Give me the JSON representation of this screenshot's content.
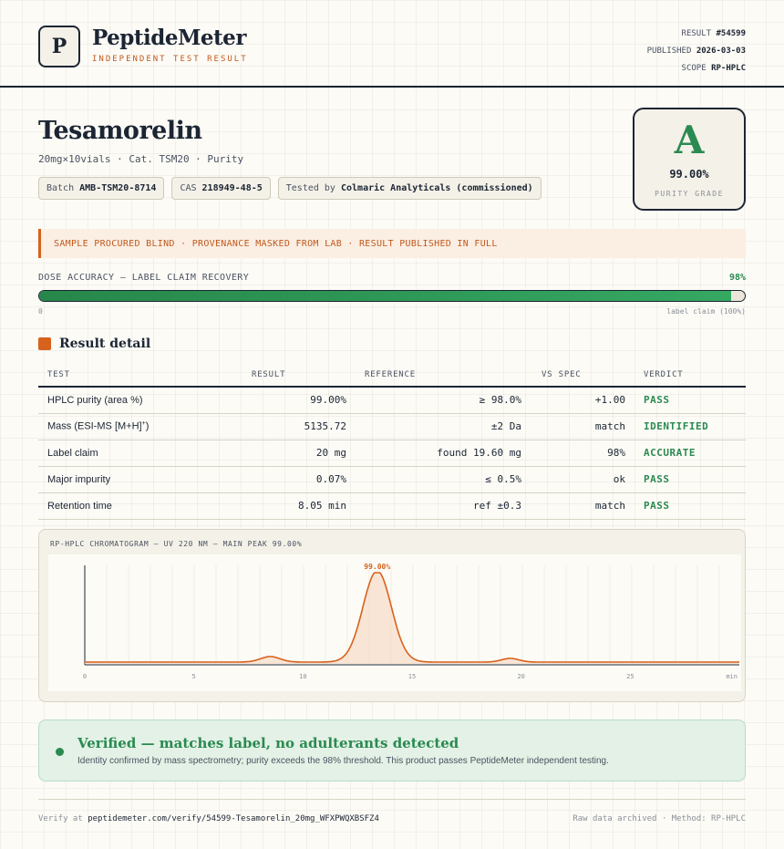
{
  "header": {
    "logo_letter": "P",
    "brand": "PeptideMeter",
    "brand_sub": "INDEPENDENT TEST RESULT",
    "result_label": "RESULT",
    "result_value": "#54599",
    "published_label": "PUBLISHED",
    "published_value": "2026-03-03",
    "scope_label": "SCOPE",
    "scope_value": "RP-HPLC"
  },
  "product": {
    "name": "Tesamorelin",
    "subtitle": "20mg×10vials · Cat. TSM20 · Purity",
    "batch_label": "Batch",
    "batch_value": "AMB-TSM20-8714",
    "cas_label": "CAS",
    "cas_value": "218949-48-5",
    "tested_label": "Tested by",
    "tested_value": "Colmaric Analyticals (commissioned)"
  },
  "grade": {
    "letter": "A",
    "value": "99.00%",
    "label": "PURITY GRADE"
  },
  "notice": "SAMPLE PROCURED BLIND · PROVENANCE MASKED FROM LAB · RESULT PUBLISHED IN FULL",
  "dose": {
    "label": "DOSE ACCURACY — LABEL CLAIM RECOVERY",
    "percent_text": "98%",
    "fraction": 0.98,
    "min_label": "0",
    "max_label": "label claim (100%)"
  },
  "results": {
    "title": "Result detail",
    "columns": [
      "TEST",
      "RESULT",
      "REFERENCE",
      "VS SPEC",
      "VERDICT"
    ],
    "rows": [
      {
        "test": "HPLC purity (area %)",
        "test_sup": "",
        "result": "99.00%",
        "reference": "≥ 98.0%",
        "vs_spec": "+1.00",
        "verdict": "PASS"
      },
      {
        "test": "Mass (ESI-MS [M+H]",
        "test_sup": "+",
        "test_tail": ")",
        "result": "5135.72",
        "reference": "±2 Da",
        "vs_spec": "match",
        "verdict": "IDENTIFIED"
      },
      {
        "test": "Label claim",
        "test_sup": "",
        "result": "20 mg",
        "reference": "found 19.60 mg",
        "vs_spec": "98%",
        "verdict": "ACCURATE"
      },
      {
        "test": "Major impurity",
        "test_sup": "",
        "result": "0.07%",
        "reference": "≤ 0.5%",
        "vs_spec": "ok",
        "verdict": "PASS"
      },
      {
        "test": "Retention time",
        "test_sup": "",
        "result": "8.05 min",
        "reference": "ref ±0.3",
        "vs_spec": "match",
        "verdict": "PASS"
      }
    ]
  },
  "chromatogram": {
    "title": "RP-HPLC CHROMATOGRAM — UV 220 NM — MAIN PEAK 99.00%",
    "peak_label": "99.00%",
    "x_ticks": [
      "0",
      "5",
      "10",
      "15",
      "20",
      "25"
    ],
    "x_unit": "min",
    "x_min": 0,
    "x_max": 30,
    "baseline": 0.02,
    "peaks": [
      {
        "center": 8.5,
        "height": 0.06,
        "width": 0.45
      },
      {
        "center": 13.4,
        "height": 1.0,
        "width": 0.65
      },
      {
        "center": 19.5,
        "height": 0.04,
        "width": 0.4
      }
    ],
    "line_color": "#d7621c",
    "fill_color": "#f8dcc8"
  },
  "verified": {
    "title": "Verified — matches label, no adulterants detected",
    "subtitle": "Identity confirmed by mass spectrometry; purity exceeds the 98% threshold. This product passes PeptideMeter independent testing."
  },
  "footer": {
    "verify_prefix": "Verify at",
    "verify_url": "peptidemeter.com/verify/54599-Tesamorelin_20mg_WFXPWQXBSFZ4",
    "right": "Raw data archived · Method: RP-HPLC"
  },
  "colors": {
    "accent_orange": "#d7621c",
    "pass_green": "#2a8a50",
    "ink": "#1c2533"
  }
}
